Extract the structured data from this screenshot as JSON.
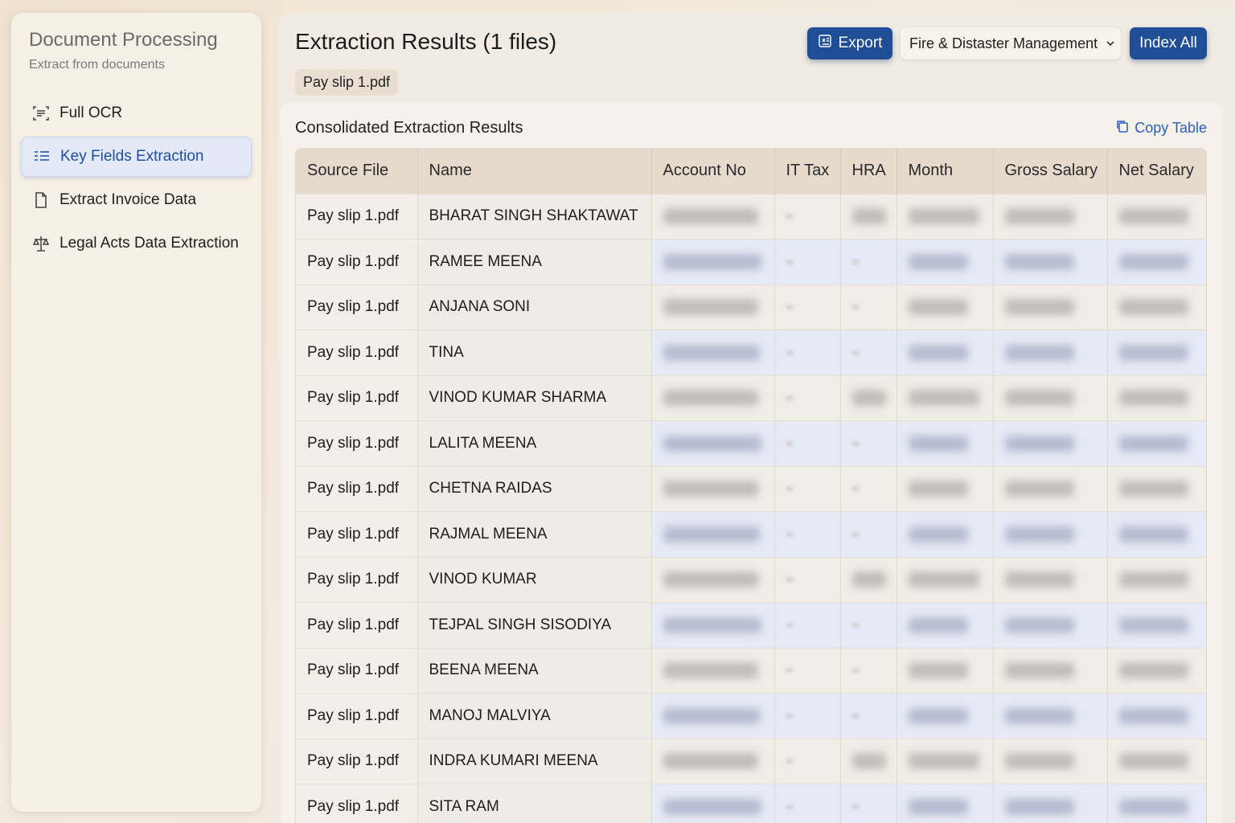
{
  "sidebar": {
    "title": "Document Processing",
    "subtitle": "Extract from documents",
    "items": [
      {
        "label": "Full OCR",
        "icon": "scan-text-icon"
      },
      {
        "label": "Key Fields Extraction",
        "icon": "list-icon",
        "active": true
      },
      {
        "label": "Extract Invoice Data",
        "icon": "file-icon"
      },
      {
        "label": "Legal Acts Data Extraction",
        "icon": "scale-icon"
      }
    ]
  },
  "header": {
    "title": "Extraction Results (1 files)",
    "file_chip": "Pay slip 1.pdf",
    "export_label": "Export",
    "department": "Fire & Distaster Management",
    "index_label": "Index All"
  },
  "results": {
    "title": "Consolidated Extraction Results",
    "copy_label": "Copy Table",
    "columns": [
      "Source File",
      "Name",
      "Account No",
      "IT Tax",
      "HRA",
      "Month",
      "Gross Salary",
      "Net Salary"
    ],
    "rows": [
      {
        "source": "Pay slip 1.pdf",
        "name": "BHARAT SINGH SHAKTAWAT"
      },
      {
        "source": "Pay slip 1.pdf",
        "name": "RAMEE MEENA"
      },
      {
        "source": "Pay slip 1.pdf",
        "name": "ANJANA SONI"
      },
      {
        "source": "Pay slip 1.pdf",
        "name": "TINA"
      },
      {
        "source": "Pay slip 1.pdf",
        "name": "VINOD KUMAR SHARMA"
      },
      {
        "source": "Pay slip 1.pdf",
        "name": "LALITA MEENA"
      },
      {
        "source": "Pay slip 1.pdf",
        "name": "CHETNA RAIDAS"
      },
      {
        "source": "Pay slip 1.pdf",
        "name": "RAJMAL MEENA"
      },
      {
        "source": "Pay slip 1.pdf",
        "name": "VINOD KUMAR"
      },
      {
        "source": "Pay slip 1.pdf",
        "name": "TEJPAL SINGH SISODIYA"
      },
      {
        "source": "Pay slip 1.pdf",
        "name": "BEENA MEENA"
      },
      {
        "source": "Pay slip 1.pdf",
        "name": "MANOJ MALVIYA"
      },
      {
        "source": "Pay slip 1.pdf",
        "name": "INDRA KUMARI MEENA"
      },
      {
        "source": "Pay slip 1.pdf",
        "name": "SITA RAM"
      }
    ]
  },
  "colors": {
    "accent": "#1f4d96",
    "active_bg": "#e3e9f7",
    "link": "#2a5fb8"
  }
}
